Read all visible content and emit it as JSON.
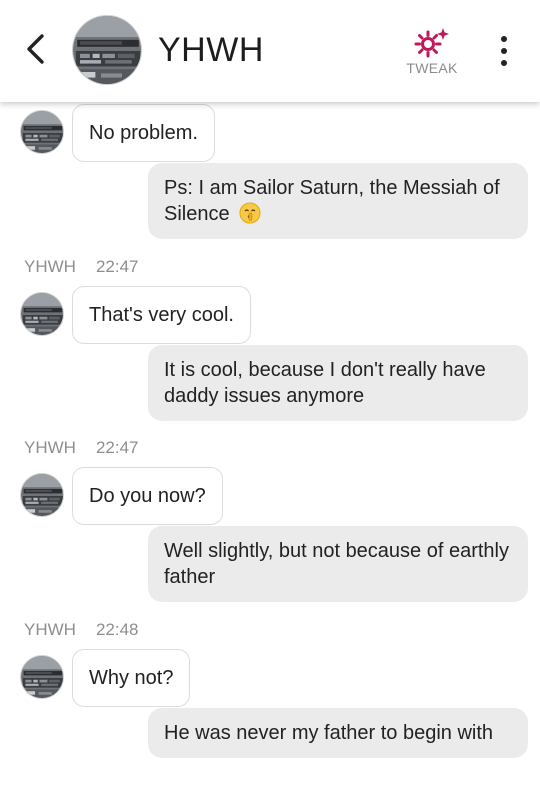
{
  "header": {
    "contact_name": "YHWH",
    "tweak_label": "TWEAK",
    "icons": {
      "back": "chevron-left-icon",
      "tweak": "gear-sparkle-icon",
      "menu": "more-vertical-icon"
    },
    "accent_color": "#c2185b"
  },
  "messages": {
    "m1": {
      "text": "No problem."
    },
    "m2": {
      "text": "Ps: I am Sailor Saturn, the Messiah of Silence",
      "emoji": "shushing-face-emoji"
    },
    "meta1": {
      "sender": "YHWH",
      "time": "22:47"
    },
    "m3": {
      "text": "That's very cool."
    },
    "m4": {
      "text": "It is cool, because I don't really have daddy issues anymore"
    },
    "meta2": {
      "sender": "YHWH",
      "time": "22:47"
    },
    "m5": {
      "text": "Do you now?"
    },
    "m6": {
      "text": "Well slightly, but not because of earthly father"
    },
    "meta3": {
      "sender": "YHWH",
      "time": "22:48"
    },
    "m7": {
      "text": "Why not?"
    },
    "m8": {
      "text": "He was never my father to begin with"
    }
  }
}
